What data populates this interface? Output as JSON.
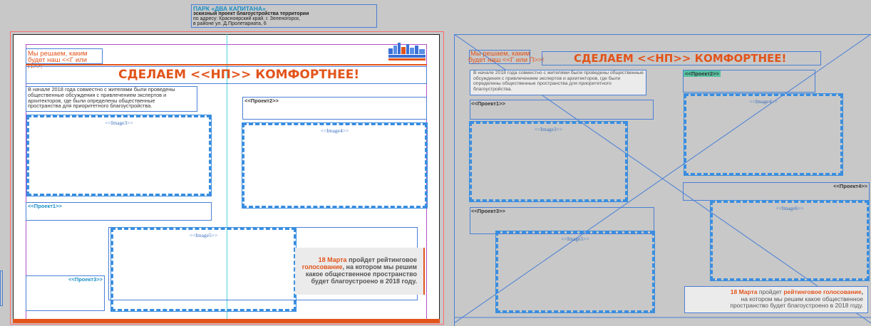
{
  "header": {
    "park_title": "ПАРК «ДВА КАПИТАНА»",
    "subtitle": "эскизный проект благоустройства территории",
    "address_line1": "по адресу: Красноярский край, г. Зеленогорск,",
    "address_line2": "в районе ул. Д.Пролетариата, 6"
  },
  "left_page": {
    "slogan_line1": "Мы решаем, каким",
    "slogan_line2": "будет наш <<Г или П>>!",
    "headline": "СДЕЛАЕМ <<НП>> КОМФОРТНЕЕ!",
    "intro": "В начале 2018 года совместно с жителями были проведены общественные обсуждения с привлечением экспертов и архитекторов, где были определены общественные  пространства для приоритетного благоустройства.",
    "project1": "<<Проект1>>",
    "project2": "<<Проект2>>",
    "project3": "<<Проект3>>",
    "image3": "<<Image3>>",
    "image4": "<<Image4>>",
    "image5": "<<Image5>>",
    "vote_date": "18 Марта",
    "vote_text1": " пройдет рейтинговое",
    "vote_text2": "голосование",
    "vote_text3": ", на котором мы решим какое общественное пространство будет благоустроено в 2018 году."
  },
  "right_page": {
    "slogan_line1": "Мы решаем, каким",
    "slogan_line2": "будет наш <<Г или П>>!",
    "headline": "СДЕЛАЕМ <<НП>> КОМФОРТНЕЕ!",
    "intro": "В начале 2018 года совместно с жителями были проведены общественные обсуждения с привлечением экспертов и архитекторов, где были определены общественные  пространства для приоритетного благоустройства.",
    "project1": "<<Проект1>>",
    "project2": "<<Проект2>>",
    "project3": "<<Проект3>>",
    "project4": "<<Проект4>>",
    "image3": "<<Image3>>",
    "image4": "<<Image4>>",
    "image5": "<<Image5>>",
    "image6": "<<Image6>>",
    "vote_date": "18 Марта",
    "vote_text1": " пройдет ",
    "vote_text2": "рейтинговое голосование",
    "vote_text3": ",",
    "vote_text4": "на котором мы решим какое общественное",
    "vote_text5": "пространство будет благоустроено в 2018 году."
  },
  "colors": {
    "accent": "#e2541b",
    "frame_blue": "#4a7fd6",
    "image_frame": "#3a8ee0",
    "pasteboard": "#c8c8c8"
  }
}
